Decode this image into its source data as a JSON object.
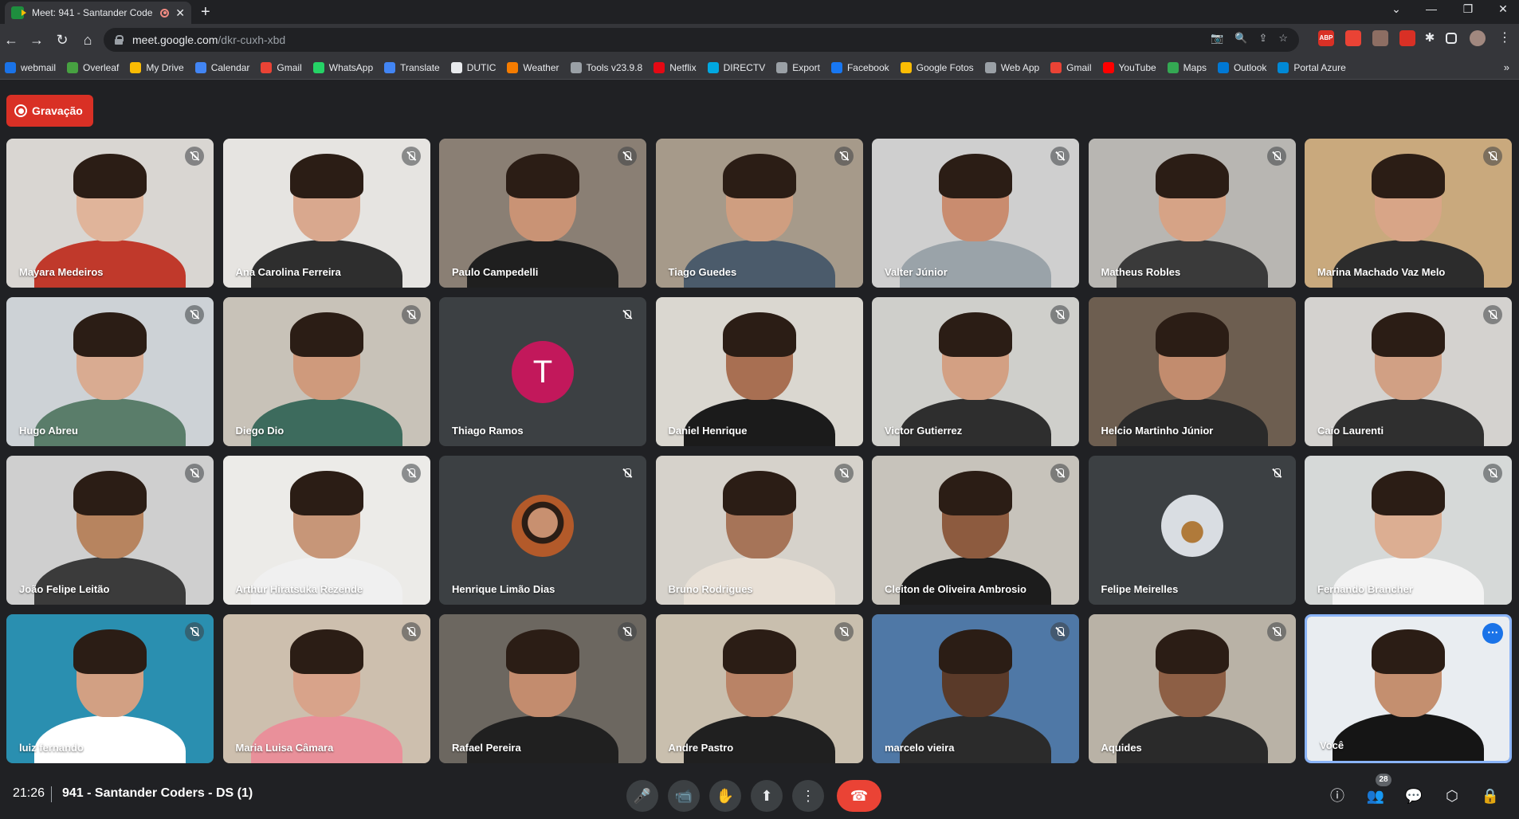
{
  "browser": {
    "tab_title": "Meet: 941 - Santander Code",
    "tab_close": "✕",
    "new_tab": "+",
    "window_controls": [
      "⌄",
      "—",
      "❐",
      "✕"
    ],
    "url_host": "meet.google.com",
    "url_path": "/dkr-cuxh-xbd",
    "nav": {
      "back": "←",
      "forward": "→",
      "reload": "↻",
      "home": "⌂"
    },
    "omnibox_icons": [
      "📷",
      "🔍",
      "⇪",
      "☆"
    ],
    "extensions": [
      "ABP",
      "",
      "",
      "",
      "",
      "",
      ""
    ]
  },
  "bookmarks": [
    {
      "label": "webmail",
      "color": "#1a73e8"
    },
    {
      "label": "Overleaf",
      "color": "#47a141"
    },
    {
      "label": "My Drive",
      "color": "#fbbc04"
    },
    {
      "label": "Calendar",
      "color": "#4285f4"
    },
    {
      "label": "Gmail",
      "color": "#ea4335"
    },
    {
      "label": "WhatsApp",
      "color": "#25d366"
    },
    {
      "label": "Translate",
      "color": "#4285f4"
    },
    {
      "label": "DUTIC",
      "color": "#e8eaed"
    },
    {
      "label": "Weather",
      "color": "#f57c00"
    },
    {
      "label": "Tools v23.9.8",
      "color": "#9aa0a6"
    },
    {
      "label": "Netflix",
      "color": "#e50914"
    },
    {
      "label": "DIRECTV",
      "color": "#00a8e1"
    },
    {
      "label": "Export",
      "color": "#9aa0a6"
    },
    {
      "label": "Facebook",
      "color": "#1877f2"
    },
    {
      "label": "Google Fotos",
      "color": "#fbbc04"
    },
    {
      "label": "Web App",
      "color": "#9aa0a6"
    },
    {
      "label": "Gmail",
      "color": "#ea4335"
    },
    {
      "label": "YouTube",
      "color": "#ff0000"
    },
    {
      "label": "Maps",
      "color": "#34a853"
    },
    {
      "label": "Outlook",
      "color": "#0078d4"
    },
    {
      "label": "Portal Azure",
      "color": "#0089d6"
    }
  ],
  "bookmarks_more": "»",
  "meet": {
    "recording_label": "Gravação",
    "participants": [
      {
        "name": "Mayara Medeiros",
        "muted": true
      },
      {
        "name": "Ana Carolina Ferreira",
        "muted": true
      },
      {
        "name": "Paulo Campedelli",
        "muted": true
      },
      {
        "name": "Tiago Guedes",
        "muted": true
      },
      {
        "name": "Valter Júnior",
        "muted": true
      },
      {
        "name": "Matheus Robles",
        "muted": true
      },
      {
        "name": "Marina Machado Vaz Melo",
        "muted": true
      },
      {
        "name": "Hugo Abreu",
        "muted": true
      },
      {
        "name": "Diego Dio",
        "muted": true
      },
      {
        "name": "Thiago Ramos",
        "muted": true,
        "avatar_letter": "T"
      },
      {
        "name": "Daniel Henrique",
        "muted": false
      },
      {
        "name": "Victor Gutierrez",
        "muted": true
      },
      {
        "name": "Helcio Martinho Júnior",
        "muted": false
      },
      {
        "name": "Caio Laurenti",
        "muted": true
      },
      {
        "name": "João Felipe Leitão",
        "muted": true
      },
      {
        "name": "Arthur Hiratsuka Rezende",
        "muted": true
      },
      {
        "name": "Henrique Limão Dias",
        "muted": true
      },
      {
        "name": "Bruno Rodrigues",
        "muted": true
      },
      {
        "name": "Cleiton de Oliveira Ambrosio",
        "muted": true
      },
      {
        "name": "Felipe Meirelles",
        "muted": true
      },
      {
        "name": "Fernando Brancher",
        "muted": true
      },
      {
        "name": "luiz fernando",
        "muted": true
      },
      {
        "name": "Maria Luisa Câmara",
        "muted": true
      },
      {
        "name": "Rafael Pereira",
        "muted": true
      },
      {
        "name": "Andre Pastro",
        "muted": true
      },
      {
        "name": "marcelo vieira",
        "muted": true
      },
      {
        "name": "Aquides",
        "muted": true
      },
      {
        "name": "Você",
        "muted": false,
        "self": true
      }
    ]
  },
  "bottom": {
    "time": "21:26",
    "meeting_title": "941 - Santander Coders - DS (1)",
    "controls": {
      "mic": "🎤",
      "camera": "📹",
      "raise_hand": "✋",
      "present": "⬆",
      "more": "⋮",
      "end_call": "☎"
    },
    "right": {
      "info": "ⓘ",
      "people": "👥",
      "people_count": "28",
      "chat": "💬",
      "activities": "⬡",
      "host": "🔒"
    }
  },
  "colors": {
    "recording": "#d93025",
    "end_call": "#ea4335",
    "self_border": "#8ab4f8",
    "avatar_t": "#c2185b"
  }
}
